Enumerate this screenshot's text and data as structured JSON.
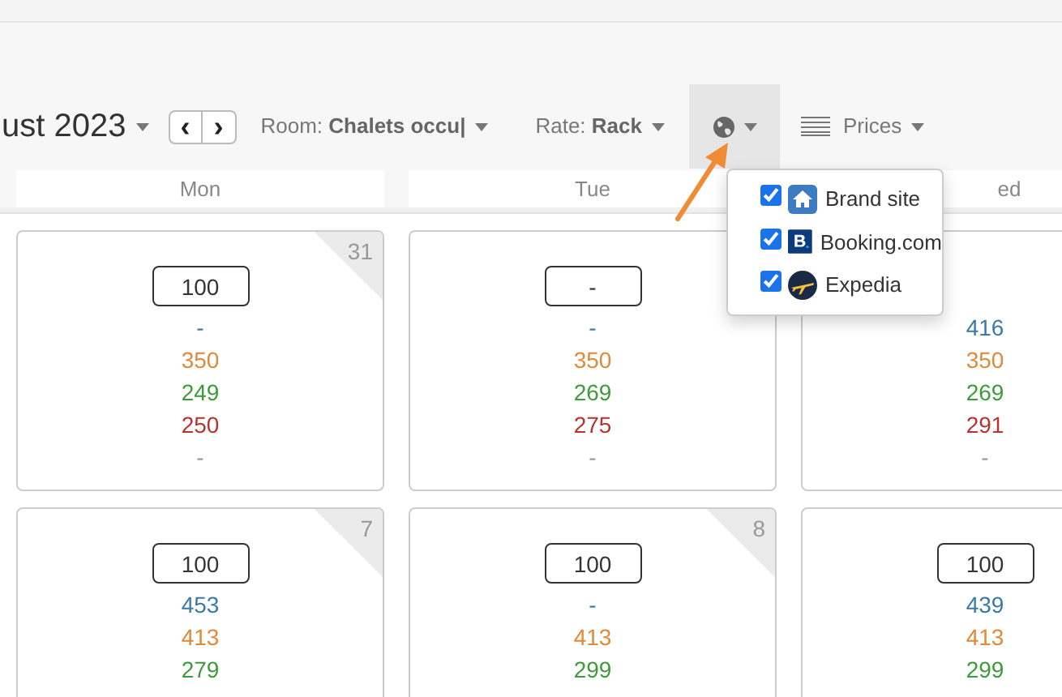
{
  "toolbar": {
    "month": "ust 2023",
    "prev": "‹",
    "next": "›",
    "room_label": "Room:",
    "room_value": "Chalets occu|",
    "rate_label": "Rate:",
    "rate_value": "Rack",
    "prices": "Prices"
  },
  "channels_menu": {
    "open": true,
    "items": [
      {
        "label": "Brand site",
        "checked": true,
        "kind": "home"
      },
      {
        "label": "Booking.com",
        "checked": true,
        "kind": "booking"
      },
      {
        "label": "Expedia",
        "checked": true,
        "kind": "plane"
      }
    ]
  },
  "weekdays": [
    "Mon",
    "Tue",
    "ed"
  ],
  "weeks": [
    [
      {
        "number": "31",
        "input": "100",
        "values": [
          {
            "text": "-",
            "kind": "blue"
          },
          {
            "text": "350",
            "kind": "orange"
          },
          {
            "text": "249",
            "kind": "green"
          },
          {
            "text": "250",
            "kind": "red"
          },
          {
            "text": "-",
            "kind": "gray"
          }
        ]
      },
      {
        "input": "-",
        "values": [
          {
            "text": "-",
            "kind": "blue"
          },
          {
            "text": "350",
            "kind": "orange"
          },
          {
            "text": "269",
            "kind": "green"
          },
          {
            "text": "275",
            "kind": "red"
          },
          {
            "text": "-",
            "kind": "gray"
          }
        ]
      },
      {
        "values": [
          {
            "text": "416",
            "kind": "blue"
          },
          {
            "text": "350",
            "kind": "orange"
          },
          {
            "text": "269",
            "kind": "green"
          },
          {
            "text": "291",
            "kind": "red"
          },
          {
            "text": "-",
            "kind": "gray"
          }
        ]
      }
    ],
    [
      {
        "number": "7",
        "input": "100",
        "values": [
          {
            "text": "453",
            "kind": "blue"
          },
          {
            "text": "413",
            "kind": "orange"
          },
          {
            "text": "279",
            "kind": "green"
          }
        ]
      },
      {
        "number": "8",
        "input": "100",
        "values": [
          {
            "text": "-",
            "kind": "blue"
          },
          {
            "text": "413",
            "kind": "orange"
          },
          {
            "text": "299",
            "kind": "green"
          }
        ]
      },
      {
        "input": "100",
        "values": [
          {
            "text": "439",
            "kind": "blue"
          },
          {
            "text": "413",
            "kind": "orange"
          },
          {
            "text": "299",
            "kind": "green"
          }
        ]
      }
    ]
  ]
}
